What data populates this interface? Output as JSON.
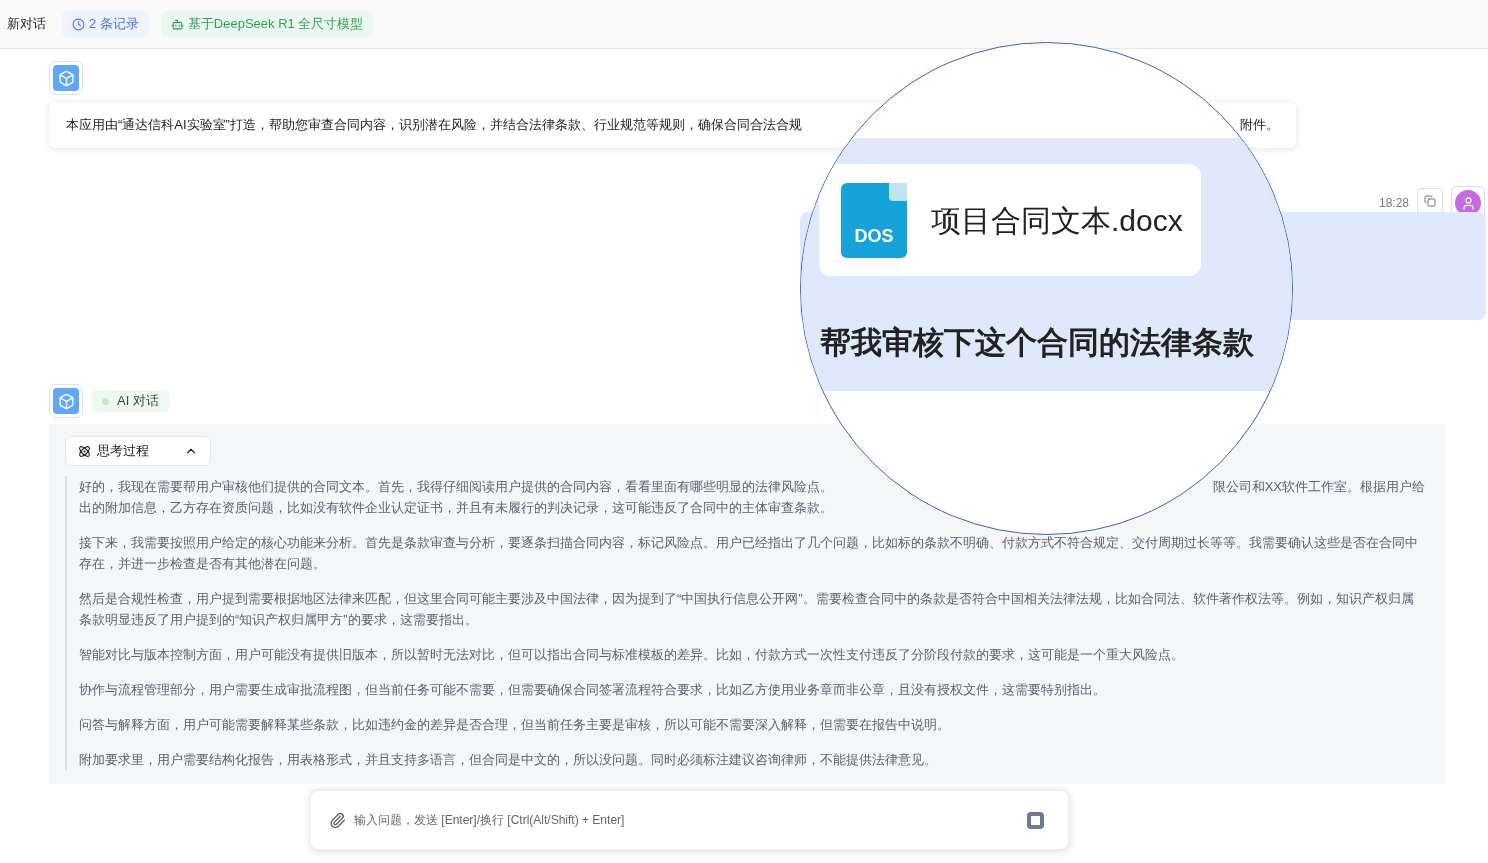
{
  "header": {
    "title": "新对话",
    "records_badge": "2 条记录",
    "model_badge": "基于DeepSeek R1 全尺寸模型"
  },
  "intro": {
    "text_left": "本应用由“通达信科AI实验室”打造，帮助您审查合同内容，识别潜在风险，并结合法律条款、行业规范等规则，确保合同合法合规",
    "text_right": "附件。"
  },
  "user_message": {
    "time": "18:28"
  },
  "magnifier": {
    "file_type": "DOS",
    "file_name": "项目合同文本.docx",
    "message": "帮我审核下这个合同的法律条款"
  },
  "ai_message": {
    "badge": "AI 对话",
    "thinking": {
      "label": "思考过程",
      "expanded": true,
      "first_line_left": "好的，我现在需要帮用户审核他们提供的合同文本。首先，我得仔细阅读用户提供的合同内容，看看里面有哪些明显的法律风险点。",
      "first_line_right": "限公司和XX软件工作室。根据用户给",
      "first_line_rest": "出的附加信息，乙方存在资质问题，比如没有软件企业认定证书，并且有未履行的判决记录，这可能违反了合同中的主体审查条款。",
      "paragraphs": [
        "接下来，我需要按照用户给定的核心功能来分析。首先是条款审查与分析，要逐条扫描合同内容，标记风险点。用户已经指出了几个问题，比如标的条款不明确、付款方式不符合规定、交付周期过长等等。我需要确认这些是否在合同中存在，并进一步检查是否有其他潜在问题。",
        "然后是合规性检查，用户提到需要根据地区法律来匹配，但这里合同可能主要涉及中国法律，因为提到了“中国执行信息公开网”。需要检查合同中的条款是否符合中国相关法律法规，比如合同法、软件著作权法等。例如，知识产权归属条款明显违反了用户提到的“知识产权归属甲方”的要求，这需要指出。",
        "智能对比与版本控制方面，用户可能没有提供旧版本，所以暂时无法对比，但可以指出合同与标准模板的差异。比如，付款方式一次性支付违反了分阶段付款的要求，这可能是一个重大风险点。",
        "协作与流程管理部分，用户需要生成审批流程图，但当前任务可能不需要，但需要确保合同签署流程符合要求，比如乙方使用业务章而非公章，且没有授权文件，这需要特别指出。",
        "问答与解释方面，用户可能需要解释某些条款，比如违约金的差异是否合理，但当前任务主要是审核，所以可能不需要深入解释，但需要在报告中说明。",
        "附加要求里，用户需要结构化报告，用表格形式，并且支持多语言，但合同是中文的，所以没问题。同时必须标注建议咨询律师，不能提供法律意见。"
      ]
    }
  },
  "composer": {
    "placeholder": "输入问题，发送 [Enter]/换行 [Ctrl(Alt/Shift) + Enter]"
  }
}
